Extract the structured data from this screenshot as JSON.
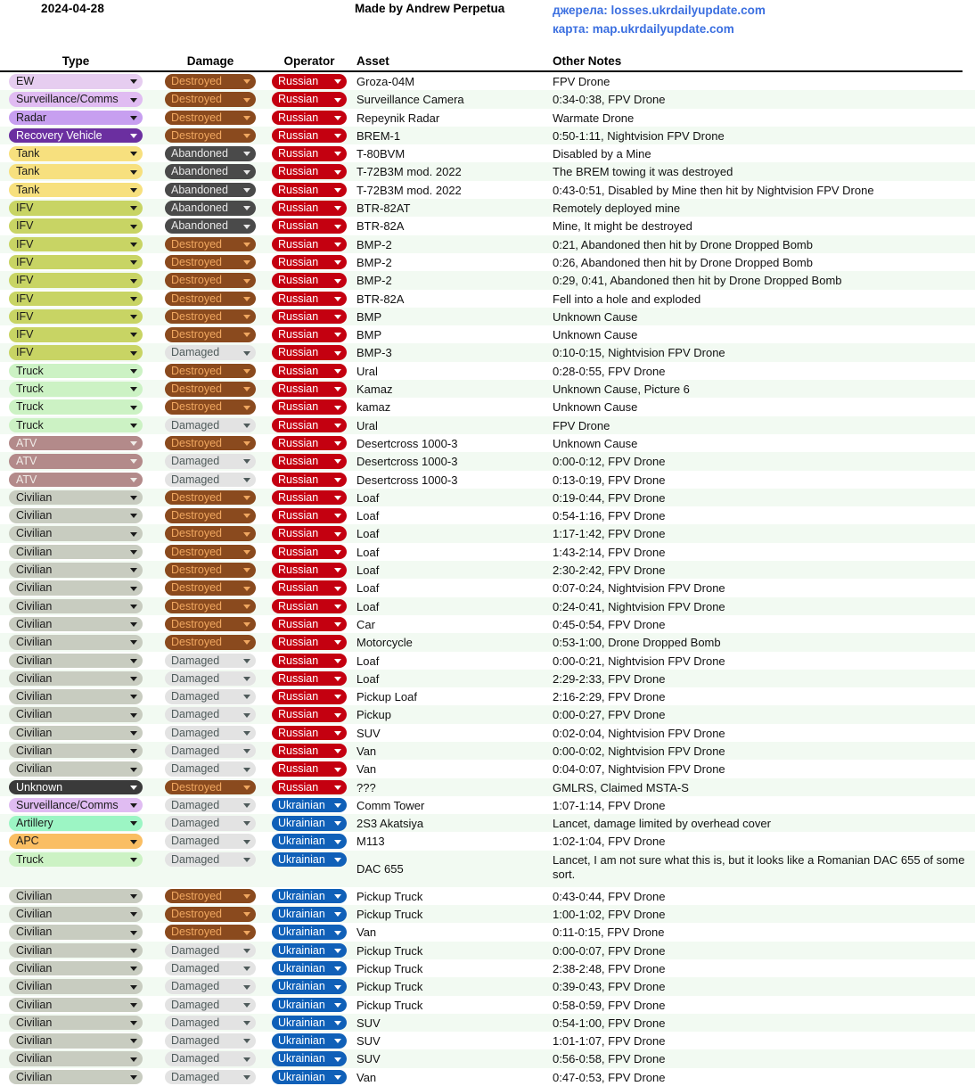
{
  "header": {
    "date": "2024-04-28",
    "credit": "Made by Andrew Perpetua",
    "link_sources": "джерела: losses.ukrdailyupdate.com",
    "link_map": "карта: map.ukrdailyupdate.com",
    "link_color": "#3b6fe0"
  },
  "columns": {
    "type": "Type",
    "damage": "Damage",
    "operator": "Operator",
    "asset": "Asset",
    "notes": "Other Notes"
  },
  "type_styles": {
    "EW": {
      "bg": "#e6cdf0",
      "fg": "#1a1a1a"
    },
    "Surveillance/Comms": {
      "bg": "#e0bcf2",
      "fg": "#1a1a1a"
    },
    "Radar": {
      "bg": "#c79ff0",
      "fg": "#1a1a1a"
    },
    "Recovery Vehicle": {
      "bg": "#6b2fa0",
      "fg": "#ffffff"
    },
    "Tank": {
      "bg": "#f7e07e",
      "fg": "#1a1a1a"
    },
    "IFV": {
      "bg": "#c8d464",
      "fg": "#1a1a1a"
    },
    "Truck": {
      "bg": "#ccf2c4",
      "fg": "#1a1a1a"
    },
    "ATV": {
      "bg": "#b38a8a",
      "fg": "#f0ece8"
    },
    "Civilian": {
      "bg": "#c8ccc0",
      "fg": "#1a1a1a"
    },
    "Unknown": {
      "bg": "#3a3a3a",
      "fg": "#ffffff"
    },
    "Artillery": {
      "bg": "#9cf5c4",
      "fg": "#1a1a1a"
    },
    "APC": {
      "bg": "#fabe63",
      "fg": "#1a1a1a"
    }
  },
  "damage_styles": {
    "Destroyed": {
      "bg": "#8a4a1e",
      "fg": "#f0a760"
    },
    "Abandoned": {
      "bg": "#4a4a4a",
      "fg": "#e8e8e8"
    },
    "Damaged": {
      "bg": "#e3e3e3",
      "fg": "#4f5b5b"
    }
  },
  "operator_styles": {
    "Russian": {
      "bg": "#c40010",
      "fg": "#ffffff"
    },
    "Ukrainian": {
      "bg": "#1060b8",
      "fg": "#ffffff"
    }
  },
  "rows": [
    {
      "type": "EW",
      "damage": "Destroyed",
      "operator": "Russian",
      "asset": "Groza-04M",
      "notes": "FPV Drone"
    },
    {
      "type": "Surveillance/Comms",
      "damage": "Destroyed",
      "operator": "Russian",
      "asset": "Surveillance Camera",
      "notes": "0:34-0:38, FPV Drone"
    },
    {
      "type": "Radar",
      "damage": "Destroyed",
      "operator": "Russian",
      "asset": "Repeynik Radar",
      "notes": "Warmate Drone"
    },
    {
      "type": "Recovery Vehicle",
      "damage": "Destroyed",
      "operator": "Russian",
      "asset": "BREM-1",
      "notes": "0:50-1:11, Nightvision FPV Drone"
    },
    {
      "type": "Tank",
      "damage": "Abandoned",
      "operator": "Russian",
      "asset": "T-80BVM",
      "notes": "Disabled by a Mine"
    },
    {
      "type": "Tank",
      "damage": "Abandoned",
      "operator": "Russian",
      "asset": "T-72B3M mod. 2022",
      "notes": "The BREM towing it was destroyed"
    },
    {
      "type": "Tank",
      "damage": "Abandoned",
      "operator": "Russian",
      "asset": "T-72B3M mod. 2022",
      "notes": "0:43-0:51, Disabled by Mine then hit by Nightvision FPV Drone"
    },
    {
      "type": "IFV",
      "damage": "Abandoned",
      "operator": "Russian",
      "asset": "BTR-82AT",
      "notes": "Remotely deployed mine"
    },
    {
      "type": "IFV",
      "damage": "Abandoned",
      "operator": "Russian",
      "asset": "BTR-82A",
      "notes": "Mine, It might be destroyed"
    },
    {
      "type": "IFV",
      "damage": "Destroyed",
      "operator": "Russian",
      "asset": "BMP-2",
      "notes": "0:21, Abandoned then hit by Drone Dropped Bomb"
    },
    {
      "type": "IFV",
      "damage": "Destroyed",
      "operator": "Russian",
      "asset": "BMP-2",
      "notes": "0:26, Abandoned then hit by Drone Dropped Bomb"
    },
    {
      "type": "IFV",
      "damage": "Destroyed",
      "operator": "Russian",
      "asset": "BMP-2",
      "notes": "0:29, 0:41, Abandoned then hit by Drone Dropped Bomb"
    },
    {
      "type": "IFV",
      "damage": "Destroyed",
      "operator": "Russian",
      "asset": "BTR-82A",
      "notes": "Fell into a hole and exploded"
    },
    {
      "type": "IFV",
      "damage": "Destroyed",
      "operator": "Russian",
      "asset": "BMP",
      "notes": "Unknown Cause"
    },
    {
      "type": "IFV",
      "damage": "Destroyed",
      "operator": "Russian",
      "asset": "BMP",
      "notes": "Unknown Cause"
    },
    {
      "type": "IFV",
      "damage": "Damaged",
      "operator": "Russian",
      "asset": "BMP-3",
      "notes": "0:10-0:15, Nightvision FPV Drone"
    },
    {
      "type": "Truck",
      "damage": "Destroyed",
      "operator": "Russian",
      "asset": "Ural",
      "notes": "0:28-0:55, FPV Drone"
    },
    {
      "type": "Truck",
      "damage": "Destroyed",
      "operator": "Russian",
      "asset": "Kamaz",
      "notes": "Unknown Cause, Picture 6"
    },
    {
      "type": "Truck",
      "damage": "Destroyed",
      "operator": "Russian",
      "asset": "kamaz",
      "notes": "Unknown Cause"
    },
    {
      "type": "Truck",
      "damage": "Damaged",
      "operator": "Russian",
      "asset": "Ural",
      "notes": "FPV Drone"
    },
    {
      "type": "ATV",
      "damage": "Destroyed",
      "operator": "Russian",
      "asset": "Desertcross 1000-3",
      "notes": "Unknown Cause"
    },
    {
      "type": "ATV",
      "damage": "Damaged",
      "operator": "Russian",
      "asset": "Desertcross 1000-3",
      "notes": "0:00-0:12, FPV Drone"
    },
    {
      "type": "ATV",
      "damage": "Damaged",
      "operator": "Russian",
      "asset": "Desertcross 1000-3",
      "notes": "0:13-0:19, FPV Drone"
    },
    {
      "type": "Civilian",
      "damage": "Destroyed",
      "operator": "Russian",
      "asset": "Loaf",
      "notes": "0:19-0:44, FPV Drone"
    },
    {
      "type": "Civilian",
      "damage": "Destroyed",
      "operator": "Russian",
      "asset": "Loaf",
      "notes": "0:54-1:16, FPV Drone"
    },
    {
      "type": "Civilian",
      "damage": "Destroyed",
      "operator": "Russian",
      "asset": "Loaf",
      "notes": "1:17-1:42, FPV Drone"
    },
    {
      "type": "Civilian",
      "damage": "Destroyed",
      "operator": "Russian",
      "asset": "Loaf",
      "notes": "1:43-2:14, FPV Drone"
    },
    {
      "type": "Civilian",
      "damage": "Destroyed",
      "operator": "Russian",
      "asset": "Loaf",
      "notes": "2:30-2:42, FPV Drone"
    },
    {
      "type": "Civilian",
      "damage": "Destroyed",
      "operator": "Russian",
      "asset": "Loaf",
      "notes": "0:07-0:24, Nightvision FPV Drone"
    },
    {
      "type": "Civilian",
      "damage": "Destroyed",
      "operator": "Russian",
      "asset": "Loaf",
      "notes": "0:24-0:41, Nightvision FPV Drone"
    },
    {
      "type": "Civilian",
      "damage": "Destroyed",
      "operator": "Russian",
      "asset": "Car",
      "notes": "0:45-0:54, FPV Drone"
    },
    {
      "type": "Civilian",
      "damage": "Destroyed",
      "operator": "Russian",
      "asset": "Motorcycle",
      "notes": "0:53-1:00, Drone Dropped Bomb"
    },
    {
      "type": "Civilian",
      "damage": "Damaged",
      "operator": "Russian",
      "asset": "Loaf",
      "notes": "0:00-0:21, Nightvision FPV Drone"
    },
    {
      "type": "Civilian",
      "damage": "Damaged",
      "operator": "Russian",
      "asset": "Loaf",
      "notes": "2:29-2:33, FPV Drone"
    },
    {
      "type": "Civilian",
      "damage": "Damaged",
      "operator": "Russian",
      "asset": "Pickup Loaf",
      "notes": "2:16-2:29, FPV Drone"
    },
    {
      "type": "Civilian",
      "damage": "Damaged",
      "operator": "Russian",
      "asset": "Pickup",
      "notes": "0:00-0:27, FPV Drone"
    },
    {
      "type": "Civilian",
      "damage": "Damaged",
      "operator": "Russian",
      "asset": "SUV",
      "notes": "0:02-0:04, Nightvision FPV Drone"
    },
    {
      "type": "Civilian",
      "damage": "Damaged",
      "operator": "Russian",
      "asset": "Van",
      "notes": "0:00-0:02, Nightvision FPV Drone"
    },
    {
      "type": "Civilian",
      "damage": "Damaged",
      "operator": "Russian",
      "asset": "Van",
      "notes": "0:04-0:07, Nightvision FPV Drone"
    },
    {
      "type": "Unknown",
      "damage": "Destroyed",
      "operator": "Russian",
      "asset": "???",
      "notes": "GMLRS, Claimed MSTA-S"
    },
    {
      "type": "Surveillance/Comms",
      "damage": "Damaged",
      "operator": "Ukrainian",
      "asset": "Comm Tower",
      "notes": "1:07-1:14, FPV Drone"
    },
    {
      "type": "Artillery",
      "damage": "Damaged",
      "operator": "Ukrainian",
      "asset": "2S3 Akatsiya",
      "notes": "Lancet, damage limited by overhead cover"
    },
    {
      "type": "APC",
      "damage": "Damaged",
      "operator": "Ukrainian",
      "asset": "M113",
      "notes": "1:02-1:04, FPV Drone"
    },
    {
      "type": "Truck",
      "damage": "Damaged",
      "operator": "Ukrainian",
      "asset": "DAC 655",
      "notes": "Lancet, I am not sure what this is, but it looks like a Romanian DAC 655 of some sort.",
      "tall": true
    },
    {
      "type": "Civilian",
      "damage": "Destroyed",
      "operator": "Ukrainian",
      "asset": "Pickup Truck",
      "notes": "0:43-0:44, FPV Drone"
    },
    {
      "type": "Civilian",
      "damage": "Destroyed",
      "operator": "Ukrainian",
      "asset": "Pickup Truck",
      "notes": "1:00-1:02, FPV Drone"
    },
    {
      "type": "Civilian",
      "damage": "Destroyed",
      "operator": "Ukrainian",
      "asset": "Van",
      "notes": "0:11-0:15, FPV Drone"
    },
    {
      "type": "Civilian",
      "damage": "Damaged",
      "operator": "Ukrainian",
      "asset": "Pickup Truck",
      "notes": "0:00-0:07, FPV Drone"
    },
    {
      "type": "Civilian",
      "damage": "Damaged",
      "operator": "Ukrainian",
      "asset": "Pickup Truck",
      "notes": "2:38-2:48, FPV Drone"
    },
    {
      "type": "Civilian",
      "damage": "Damaged",
      "operator": "Ukrainian",
      "asset": "Pickup Truck",
      "notes": "0:39-0:43, FPV Drone"
    },
    {
      "type": "Civilian",
      "damage": "Damaged",
      "operator": "Ukrainian",
      "asset": "Pickup Truck",
      "notes": "0:58-0:59, FPV Drone"
    },
    {
      "type": "Civilian",
      "damage": "Damaged",
      "operator": "Ukrainian",
      "asset": "SUV",
      "notes": "0:54-1:00, FPV Drone"
    },
    {
      "type": "Civilian",
      "damage": "Damaged",
      "operator": "Ukrainian",
      "asset": "SUV",
      "notes": "1:01-1:07, FPV Drone"
    },
    {
      "type": "Civilian",
      "damage": "Damaged",
      "operator": "Ukrainian",
      "asset": "SUV",
      "notes": "0:56-0:58, FPV Drone"
    },
    {
      "type": "Civilian",
      "damage": "Damaged",
      "operator": "Ukrainian",
      "asset": "Van",
      "notes": "0:47-0:53, FPV Drone"
    }
  ]
}
